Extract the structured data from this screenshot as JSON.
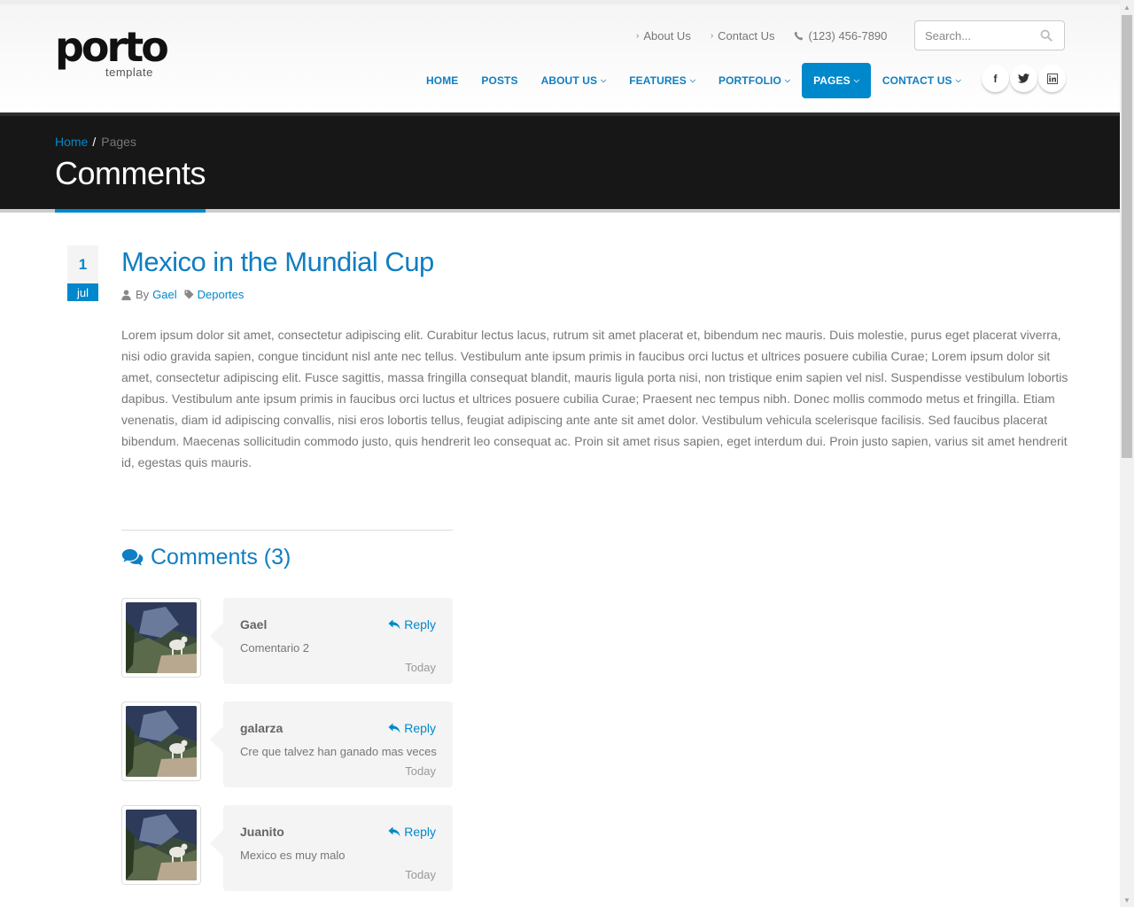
{
  "logo": {
    "word": "porto",
    "sub": "template"
  },
  "top_links": [
    {
      "label": "About Us"
    },
    {
      "label": "Contact Us"
    }
  ],
  "phone": "(123) 456-7890",
  "search": {
    "placeholder": "Search..."
  },
  "nav": [
    {
      "label": "HOME",
      "dropdown": false,
      "active": false
    },
    {
      "label": "POSTS",
      "dropdown": false,
      "active": false
    },
    {
      "label": "ABOUT US",
      "dropdown": true,
      "active": false
    },
    {
      "label": "FEATURES",
      "dropdown": true,
      "active": false
    },
    {
      "label": "PORTFOLIO",
      "dropdown": true,
      "active": false
    },
    {
      "label": "PAGES",
      "dropdown": true,
      "active": true
    },
    {
      "label": "CONTACT US",
      "dropdown": true,
      "active": false
    }
  ],
  "social": [
    {
      "icon": "facebook-icon",
      "glyph": "f"
    },
    {
      "icon": "twitter-icon",
      "glyph": "t"
    },
    {
      "icon": "linkedin-icon",
      "glyph": "in"
    }
  ],
  "breadcrumb": {
    "home": "Home",
    "separator": "/",
    "current": "Pages"
  },
  "page_title": "Comments",
  "post": {
    "day": "1",
    "month": "jul",
    "title": "Mexico in the Mundial Cup",
    "by_label": "By",
    "author": "Gael",
    "category": "Deportes",
    "body": "Lorem ipsum dolor sit amet, consectetur adipiscing elit. Curabitur lectus lacus, rutrum sit amet placerat et, bibendum nec mauris. Duis molestie, purus eget placerat viverra, nisi odio gravida sapien, congue tincidunt nisl ante nec tellus. Vestibulum ante ipsum primis in faucibus orci luctus et ultrices posuere cubilia Curae; Lorem ipsum dolor sit amet, consectetur adipiscing elit. Fusce sagittis, massa fringilla consequat blandit, mauris ligula porta nisi, non tristique enim sapien vel nisl. Suspendisse vestibulum lobortis dapibus. Vestibulum ante ipsum primis in faucibus orci luctus et ultrices posuere cubilia Curae; Praesent nec tempus nibh. Donec mollis commodo metus et fringilla. Etiam venenatis, diam id adipiscing convallis, nisi eros lobortis tellus, feugiat adipiscing ante ante sit amet dolor. Vestibulum vehicula scelerisque facilisis. Sed faucibus placerat bibendum. Maecenas sollicitudin commodo justo, quis hendrerit leo consequat ac. Proin sit amet risus sapien, eget interdum dui. Proin justo sapien, varius sit amet hendrerit id, egestas quis mauris."
  },
  "comments_title": "Comments (3)",
  "comments": [
    {
      "name": "Gael",
      "reply": "Reply",
      "text": "Comentario 2",
      "date": "Today"
    },
    {
      "name": "galarza",
      "reply": "Reply",
      "text": "Cre que talvez han ganado mas veces",
      "date": "Today"
    },
    {
      "name": "Juanito",
      "reply": "Reply",
      "text": "Mexico es muy malo",
      "date": "Today"
    }
  ],
  "colors": {
    "accent": "#0088cc",
    "page_header_bg": "#171717"
  }
}
